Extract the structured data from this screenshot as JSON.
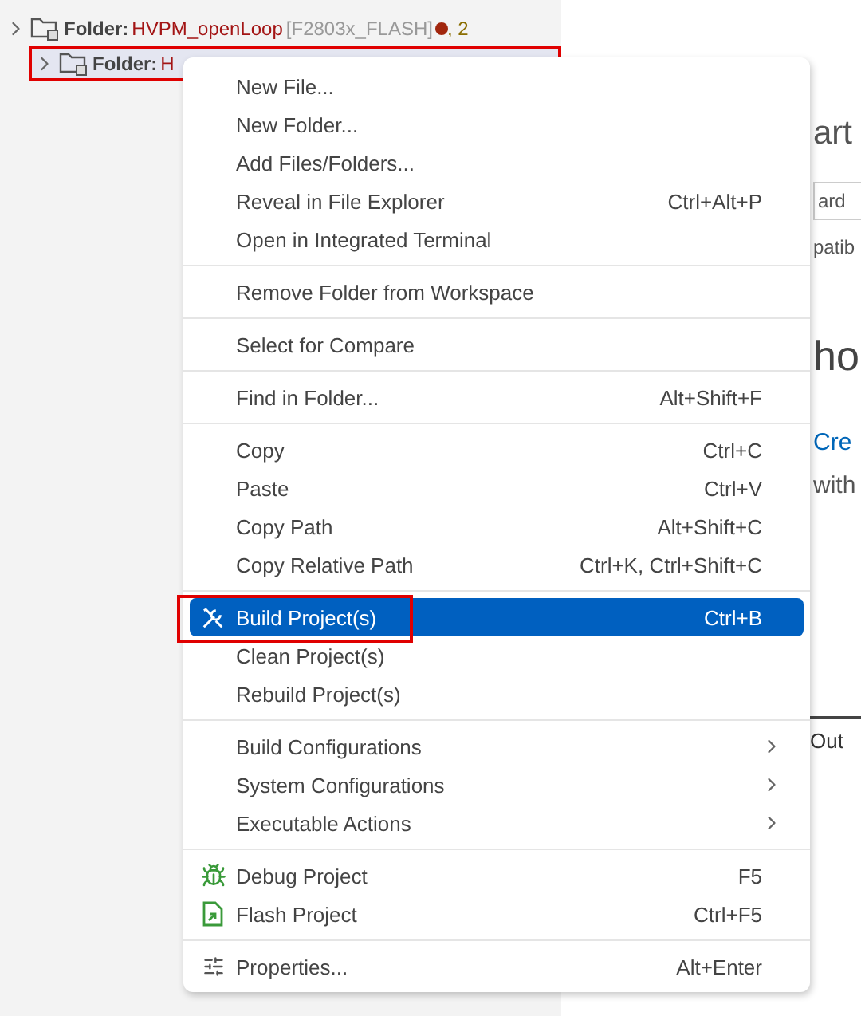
{
  "explorer": {
    "rows": [
      {
        "label": "Folder:",
        "name": "HVPM_openLoop",
        "config": "[F2803x_FLASH]",
        "error": true,
        "count": ", 2",
        "selected": false,
        "highlighted": false
      },
      {
        "label": "Folder:",
        "name": "H",
        "selected": true,
        "highlighted": true
      }
    ]
  },
  "editor": {
    "title": "art",
    "field_value": "ard",
    "note": "patib",
    "heading": "ho",
    "link": "Cre",
    "text": "with",
    "panel_tab": "Out"
  },
  "context_menu": {
    "groups": [
      [
        {
          "label": "New File..."
        },
        {
          "label": "New Folder..."
        },
        {
          "label": "Add Files/Folders..."
        },
        {
          "label": "Reveal in File Explorer",
          "shortcut": "Ctrl+Alt+P"
        },
        {
          "label": "Open in Integrated Terminal"
        }
      ],
      [
        {
          "label": "Remove Folder from Workspace"
        }
      ],
      [
        {
          "label": "Select for Compare"
        }
      ],
      [
        {
          "label": "Find in Folder...",
          "shortcut": "Alt+Shift+F"
        }
      ],
      [
        {
          "label": "Copy",
          "shortcut": "Ctrl+C"
        },
        {
          "label": "Paste",
          "shortcut": "Ctrl+V"
        },
        {
          "label": "Copy Path",
          "shortcut": "Alt+Shift+C"
        },
        {
          "label": "Copy Relative Path",
          "shortcut": "Ctrl+K, Ctrl+Shift+C"
        }
      ],
      [
        {
          "label": "Build Project(s)",
          "shortcut": "Ctrl+B",
          "kind": "tools",
          "selected": true,
          "highlighted": true
        },
        {
          "label": "Clean Project(s)",
          "selected": false
        },
        {
          "label": "Rebuild Project(s)",
          "selected": false
        }
      ],
      [
        {
          "label": "Build Configurations",
          "submenu": true
        },
        {
          "label": "System Configurations",
          "submenu": true
        },
        {
          "label": "Executable Actions",
          "submenu": true
        }
      ],
      [
        {
          "label": "Debug Project",
          "shortcut": "F5",
          "kind": "debug"
        },
        {
          "label": "Flash Project",
          "shortcut": "Ctrl+F5",
          "kind": "flash"
        }
      ],
      [
        {
          "label": "Properties...",
          "shortcut": "Alt+Enter",
          "kind": "properties"
        }
      ]
    ]
  }
}
